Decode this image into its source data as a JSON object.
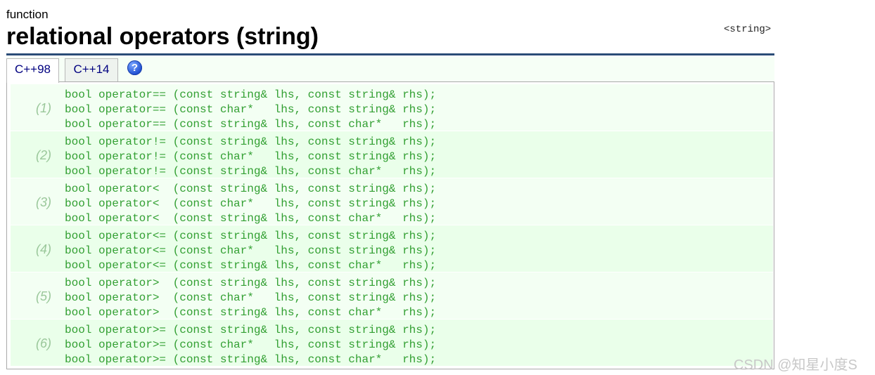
{
  "page": {
    "kind": "function",
    "title": "relational operators (string)",
    "header_tag": "<string>"
  },
  "tabs": [
    {
      "label": "C++98",
      "active": true
    },
    {
      "label": "C++14",
      "active": false
    }
  ],
  "help_icon": {
    "icon": "help-icon",
    "glyph": "?"
  },
  "groups": [
    {
      "num": "(1)",
      "lines": [
        "bool operator== (const string& lhs, const string& rhs);",
        "bool operator== (const char*   lhs, const string& rhs);",
        "bool operator== (const string& lhs, const char*   rhs);"
      ]
    },
    {
      "num": "(2)",
      "lines": [
        "bool operator!= (const string& lhs, const string& rhs);",
        "bool operator!= (const char*   lhs, const string& rhs);",
        "bool operator!= (const string& lhs, const char*   rhs);"
      ]
    },
    {
      "num": "(3)",
      "lines": [
        "bool operator<  (const string& lhs, const string& rhs);",
        "bool operator<  (const char*   lhs, const string& rhs);",
        "bool operator<  (const string& lhs, const char*   rhs);"
      ]
    },
    {
      "num": "(4)",
      "lines": [
        "bool operator<= (const string& lhs, const string& rhs);",
        "bool operator<= (const char*   lhs, const string& rhs);",
        "bool operator<= (const string& lhs, const char*   rhs);"
      ]
    },
    {
      "num": "(5)",
      "lines": [
        "bool operator>  (const string& lhs, const string& rhs);",
        "bool operator>  (const char*   lhs, const string& rhs);",
        "bool operator>  (const string& lhs, const char*   rhs);"
      ]
    },
    {
      "num": "(6)",
      "lines": [
        "bool operator>= (const string& lhs, const string& rhs);",
        "bool operator>= (const char*   lhs, const string& rhs);",
        "bool operator>= (const string& lhs, const char*   rhs);"
      ]
    }
  ],
  "watermark": "CSDN @知星小度S",
  "colors": {
    "code": "#329f32",
    "number": "#9ac79a",
    "rule": "#2b4c77",
    "tab_text": "#000080",
    "group_bg": "#f3fff3"
  }
}
